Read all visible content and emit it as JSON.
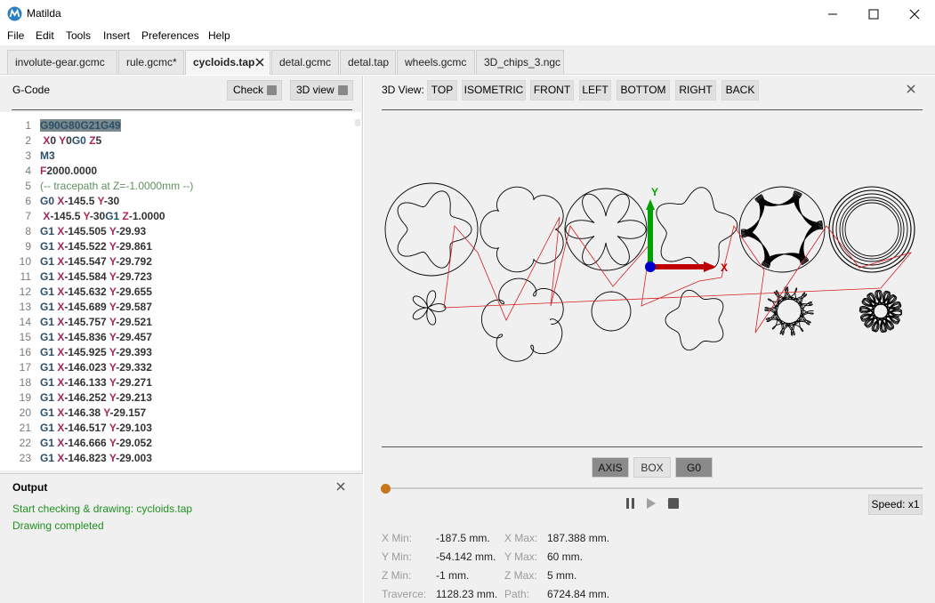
{
  "window": {
    "title": "Matilda",
    "icon": "matilda-logo-icon"
  },
  "menu": [
    "File",
    "Edit",
    "Tools",
    "Insert",
    "Preferences",
    "Help"
  ],
  "tabs": [
    {
      "label": "involute-gear.gcmc",
      "active": false
    },
    {
      "label": "rule.gcmc*",
      "active": false
    },
    {
      "label": "cycloids.tap",
      "active": true
    },
    {
      "label": "detal.gcmc",
      "active": false
    },
    {
      "label": "detal.tap",
      "active": false
    },
    {
      "label": "wheels.gcmc",
      "active": false
    },
    {
      "label": "3D_chips_3.ngc",
      "active": false
    }
  ],
  "gcode": {
    "title": "G-Code",
    "check_label": "Check",
    "view3d_label": "3D view",
    "lines": [
      {
        "n": "1",
        "segs": [
          [
            "g sel",
            "G90G80G21G49"
          ]
        ]
      },
      {
        "n": "2",
        "segs": [
          [
            "a",
            " X"
          ],
          [
            "n",
            "0 "
          ],
          [
            "a",
            "Y"
          ],
          [
            "n",
            "0"
          ],
          [
            "g",
            "G0 "
          ],
          [
            "a",
            "Z"
          ],
          [
            "n",
            "5"
          ]
        ]
      },
      {
        "n": "3",
        "segs": [
          [
            "g",
            "M3"
          ]
        ]
      },
      {
        "n": "4",
        "segs": [
          [
            "a",
            "F"
          ],
          [
            "n",
            "2000.0000"
          ]
        ]
      },
      {
        "n": "5",
        "segs": [
          [
            "c",
            "(-- tracepath at Z=-1.0000mm --)"
          ]
        ]
      },
      {
        "n": "6",
        "segs": [
          [
            "g",
            "G0 "
          ],
          [
            "a",
            "X"
          ],
          [
            "n",
            "-145.5 "
          ],
          [
            "a",
            "Y"
          ],
          [
            "n",
            "-30"
          ]
        ]
      },
      {
        "n": "7",
        "segs": [
          [
            "a",
            " X"
          ],
          [
            "n",
            "-145.5 "
          ],
          [
            "a",
            "Y"
          ],
          [
            "n",
            "-30"
          ],
          [
            "g",
            "G1 "
          ],
          [
            "a",
            "Z"
          ],
          [
            "n",
            "-1.0000"
          ]
        ]
      },
      {
        "n": "8",
        "segs": [
          [
            "g",
            "G1 "
          ],
          [
            "a",
            "X"
          ],
          [
            "n",
            "-145.505 "
          ],
          [
            "a",
            "Y"
          ],
          [
            "n",
            "-29.93"
          ]
        ]
      },
      {
        "n": "9",
        "segs": [
          [
            "g",
            "G1 "
          ],
          [
            "a",
            "X"
          ],
          [
            "n",
            "-145.522 "
          ],
          [
            "a",
            "Y"
          ],
          [
            "n",
            "-29.861"
          ]
        ]
      },
      {
        "n": "10",
        "segs": [
          [
            "g",
            "G1 "
          ],
          [
            "a",
            "X"
          ],
          [
            "n",
            "-145.547 "
          ],
          [
            "a",
            "Y"
          ],
          [
            "n",
            "-29.792"
          ]
        ]
      },
      {
        "n": "11",
        "segs": [
          [
            "g",
            "G1 "
          ],
          [
            "a",
            "X"
          ],
          [
            "n",
            "-145.584 "
          ],
          [
            "a",
            "Y"
          ],
          [
            "n",
            "-29.723"
          ]
        ]
      },
      {
        "n": "12",
        "segs": [
          [
            "g",
            "G1 "
          ],
          [
            "a",
            "X"
          ],
          [
            "n",
            "-145.632 "
          ],
          [
            "a",
            "Y"
          ],
          [
            "n",
            "-29.655"
          ]
        ]
      },
      {
        "n": "13",
        "segs": [
          [
            "g",
            "G1 "
          ],
          [
            "a",
            "X"
          ],
          [
            "n",
            "-145.689 "
          ],
          [
            "a",
            "Y"
          ],
          [
            "n",
            "-29.587"
          ]
        ]
      },
      {
        "n": "14",
        "segs": [
          [
            "g",
            "G1 "
          ],
          [
            "a",
            "X"
          ],
          [
            "n",
            "-145.757 "
          ],
          [
            "a",
            "Y"
          ],
          [
            "n",
            "-29.521"
          ]
        ]
      },
      {
        "n": "15",
        "segs": [
          [
            "g",
            "G1 "
          ],
          [
            "a",
            "X"
          ],
          [
            "n",
            "-145.836 "
          ],
          [
            "a",
            "Y"
          ],
          [
            "n",
            "-29.457"
          ]
        ]
      },
      {
        "n": "16",
        "segs": [
          [
            "g",
            "G1 "
          ],
          [
            "a",
            "X"
          ],
          [
            "n",
            "-145.925 "
          ],
          [
            "a",
            "Y"
          ],
          [
            "n",
            "-29.393"
          ]
        ]
      },
      {
        "n": "17",
        "segs": [
          [
            "g",
            "G1 "
          ],
          [
            "a",
            "X"
          ],
          [
            "n",
            "-146.023 "
          ],
          [
            "a",
            "Y"
          ],
          [
            "n",
            "-29.332"
          ]
        ]
      },
      {
        "n": "18",
        "segs": [
          [
            "g",
            "G1 "
          ],
          [
            "a",
            "X"
          ],
          [
            "n",
            "-146.133 "
          ],
          [
            "a",
            "Y"
          ],
          [
            "n",
            "-29.271"
          ]
        ]
      },
      {
        "n": "19",
        "segs": [
          [
            "g",
            "G1 "
          ],
          [
            "a",
            "X"
          ],
          [
            "n",
            "-146.252 "
          ],
          [
            "a",
            "Y"
          ],
          [
            "n",
            "-29.213"
          ]
        ]
      },
      {
        "n": "20",
        "segs": [
          [
            "g",
            "G1 "
          ],
          [
            "a",
            "X"
          ],
          [
            "n",
            "-146.38 "
          ],
          [
            "a",
            "Y"
          ],
          [
            "n",
            "-29.157"
          ]
        ]
      },
      {
        "n": "21",
        "segs": [
          [
            "g",
            "G1 "
          ],
          [
            "a",
            "X"
          ],
          [
            "n",
            "-146.517 "
          ],
          [
            "a",
            "Y"
          ],
          [
            "n",
            "-29.103"
          ]
        ]
      },
      {
        "n": "22",
        "segs": [
          [
            "g",
            "G1 "
          ],
          [
            "a",
            "X"
          ],
          [
            "n",
            "-146.666 "
          ],
          [
            "a",
            "Y"
          ],
          [
            "n",
            "-29.052"
          ]
        ]
      },
      {
        "n": "23",
        "segs": [
          [
            "g",
            "G1 "
          ],
          [
            "a",
            "X"
          ],
          [
            "n",
            "-146.823 "
          ],
          [
            "a",
            "Y"
          ],
          [
            "n",
            "-29.003"
          ]
        ]
      }
    ]
  },
  "output": {
    "title": "Output",
    "lines": [
      "Start checking & drawing: cycloids.tap",
      "Drawing completed"
    ]
  },
  "view3d": {
    "label": "3D View:",
    "views": [
      "TOP",
      "ISOMETRIC",
      "FRONT",
      "LEFT",
      "BOTTOM",
      "RIGHT",
      "BACK"
    ],
    "axis_labels": {
      "x": "X",
      "y": "Y"
    },
    "toggles": [
      {
        "label": "AXIS",
        "on": true
      },
      {
        "label": "BOX",
        "on": false
      },
      {
        "label": "G0",
        "on": true
      }
    ],
    "playback_progress": 0,
    "speed_label": "Speed: x1",
    "colors": {
      "path": "#000000",
      "rapid": "#d42020",
      "x_axis": "#c00000",
      "y_axis": "#00a000",
      "origin": "#0000cc"
    }
  },
  "stats": {
    "x_min": {
      "label": "X Min:",
      "value": "-187.5 mm."
    },
    "x_max": {
      "label": "X Max:",
      "value": "187.388 mm."
    },
    "y_min": {
      "label": "Y Min:",
      "value": "-54.142 mm."
    },
    "y_max": {
      "label": "Y Max:",
      "value": "60 mm."
    },
    "z_min": {
      "label": "Z Min:",
      "value": "-1 mm."
    },
    "z_max": {
      "label": "Z Max:",
      "value": "5 mm."
    },
    "traverse": {
      "label": "Traverce:",
      "value": "1128.23 mm."
    },
    "path": {
      "label": "Path:",
      "value": "6724.84 mm."
    }
  }
}
